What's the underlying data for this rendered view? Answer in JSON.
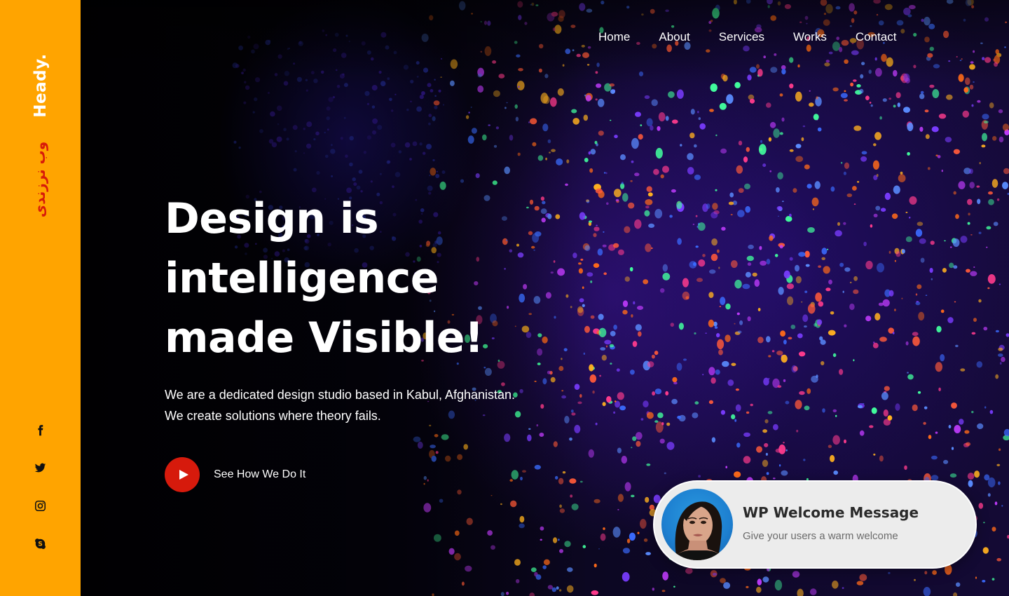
{
  "sidebar": {
    "brand": "Heady.",
    "brand_subtitle": "وب نرزندی",
    "accent_color": "#ffa400",
    "social": [
      {
        "name": "facebook-icon"
      },
      {
        "name": "twitter-icon"
      },
      {
        "name": "instagram-icon"
      },
      {
        "name": "skype-icon"
      }
    ]
  },
  "nav": {
    "items": [
      "Home",
      "About",
      "Services",
      "Works",
      "Contact"
    ]
  },
  "hero": {
    "headline": [
      "Design is",
      "intelligence",
      "made Visible!"
    ],
    "description": [
      "We are a dedicated design studio based in Kabul, Afghanistan.",
      "We create solutions where theory fails."
    ],
    "cta_label": "See How We Do It",
    "cta_icon": "play-icon",
    "cta_color": "#d61a0c"
  },
  "welcome": {
    "title": "WP Welcome Message",
    "text": "Give your users a warm welcome"
  }
}
